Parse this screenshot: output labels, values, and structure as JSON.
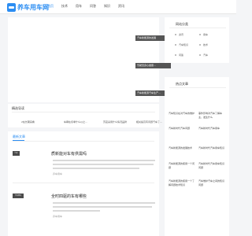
{
  "site": {
    "logo_text": "养车用车网"
  },
  "nav": [
    "首页",
    "技术",
    "用车",
    "问答",
    "知识",
    "资讯"
  ],
  "banner": {
    "tags": [
      "汽车新能源的发展",
      "驾驶员身心健康…",
      "汽车新能源汽车生产…"
    ]
  },
  "recommend": {
    "title": "精选导读",
    "items": [
      "2在长期来看",
      "车辆在冬季什么以之…",
      "苏宜采用什么情况品牌",
      "相关提高有问题汽车了…"
    ]
  },
  "latest": {
    "title": "最新文章",
    "articles": [
      {
        "thumb": "汽车",
        "title": "质新能对车有供需吗",
        "meta": "养车用车"
      },
      {
        "thumb": "汽车用车",
        "title": "全时四驱的车有哪些",
        "meta": "养车用车"
      }
    ]
  },
  "categories": {
    "title": "网站分类",
    "items": [
      "资讯",
      "用车",
      "汽车知识",
      "技术",
      "问答",
      "汽车"
    ]
  },
  "hot": {
    "title": "热点文章",
    "items": [
      "汽车知识在对汽车的维护",
      "事件影响对汽车了解车主，发生什么",
      "汽车新时代汽车问题",
      "汽车新时代汽车用车",
      "汽车新能源的发展技术",
      "汽车新时代汽车用车知识",
      "汽车新能源的使用一个问题",
      "汽车新时代汽车用车知识问题",
      "汽车新能源的使用一个了解问题技术知识",
      "汽车维护汽车之间的知识问题"
    ]
  },
  "colors": {
    "accent": "#2b8df2",
    "background": "#f4f5f7"
  }
}
